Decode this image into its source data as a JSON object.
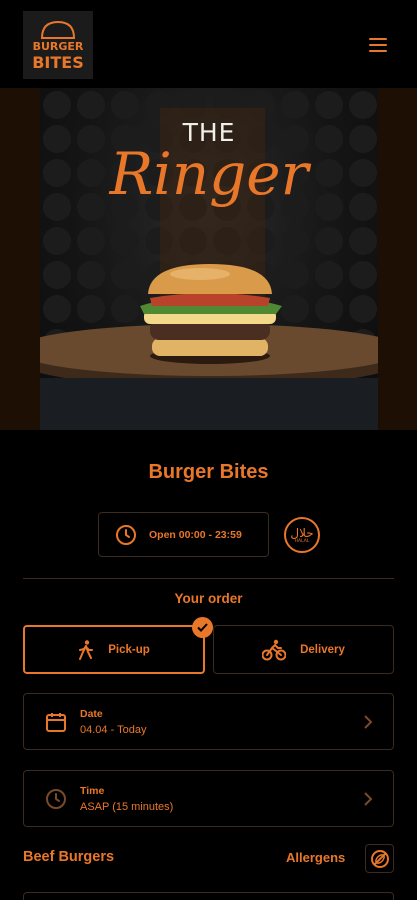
{
  "header": {
    "logo_text": "BURGER BITES",
    "menu_icon": "hamburger-menu-icon"
  },
  "hero": {
    "title_line1": "THE",
    "title_line2": "Ringer"
  },
  "restaurant": {
    "name": "Burger Bites",
    "hours": "Open 00:00 - 23:59",
    "halal_badge": "HALAL"
  },
  "order": {
    "heading": "Your order",
    "modes": [
      {
        "label": "Pick-up",
        "icon": "walking-person-icon",
        "selected": true
      },
      {
        "label": "Delivery",
        "icon": "bicycle-courier-icon",
        "selected": false
      }
    ],
    "date": {
      "label": "Date",
      "value": "04.04 - Today",
      "icon": "calendar-icon"
    },
    "time": {
      "label": "Time",
      "value": "ASAP (15 minutes)",
      "icon": "clock-icon"
    }
  },
  "menu": {
    "section_title": "Beef Burgers",
    "allergens_label": "Allergens"
  },
  "colors": {
    "accent": "#e9772a",
    "background": "#000000",
    "border": "#3b2a1e"
  }
}
